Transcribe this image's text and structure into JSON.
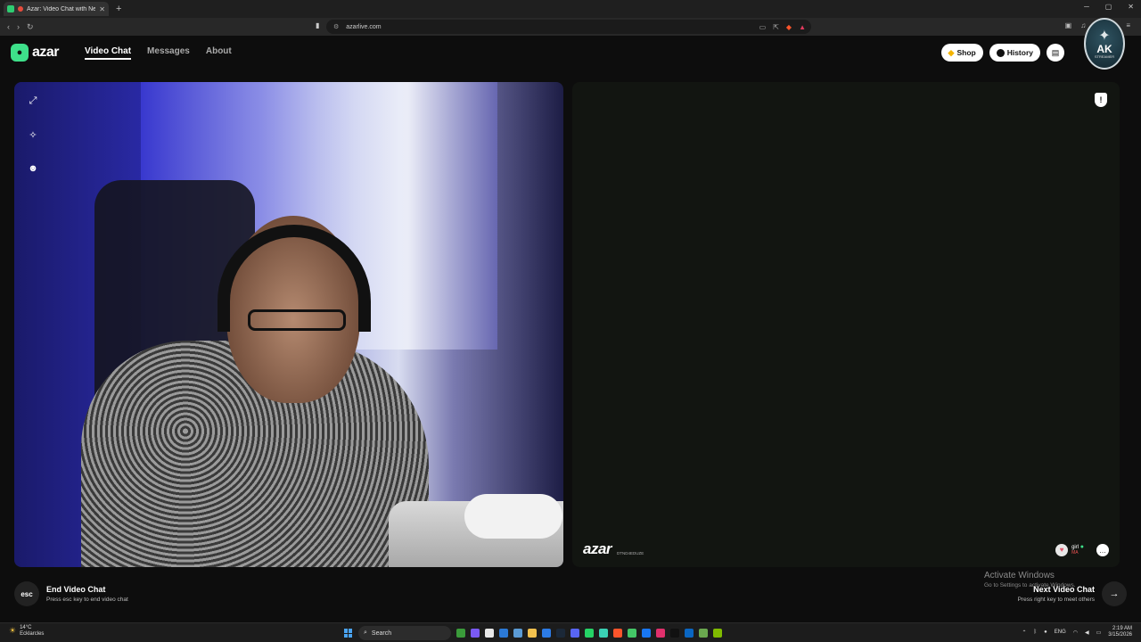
{
  "browser": {
    "tab_title": "Azar: Video Chat with New Pe",
    "tab_close": "✕",
    "new_tab": "+",
    "url": "azarlive.com",
    "window_controls": [
      "─",
      "▢",
      "✕"
    ]
  },
  "header": {
    "logo_text": "azar",
    "nav": [
      {
        "label": "Video Chat",
        "active": true
      },
      {
        "label": "Messages",
        "active": false
      },
      {
        "label": "About",
        "active": false
      }
    ],
    "shop_label": "Shop",
    "history_label": "History",
    "badge_text": "AK",
    "badge_sub": "STREAMER"
  },
  "right_panel": {
    "watermark": "azar",
    "watermark_tag": "DTND4EDUZE",
    "peer_name": "girl",
    "peer_country": "MA"
  },
  "controls": {
    "end_key": "esc",
    "end_title": "End Video Chat",
    "end_sub": "Press esc key to end video chat",
    "next_title": "Next Video Chat",
    "next_sub": "Press right key to meet others",
    "next_arrow": "→"
  },
  "activate": {
    "title": "Activate Windows",
    "sub": "Go to Settings to activate Windows."
  },
  "taskbar": {
    "temp": "14°C",
    "weather_desc": "Ecklarcles",
    "search": "Search",
    "lang": "ENG",
    "time": "2:19 AM",
    "date": "3/15/2026"
  },
  "colors": {
    "accent": "#3ee08a",
    "background": "#0d0d0d"
  }
}
